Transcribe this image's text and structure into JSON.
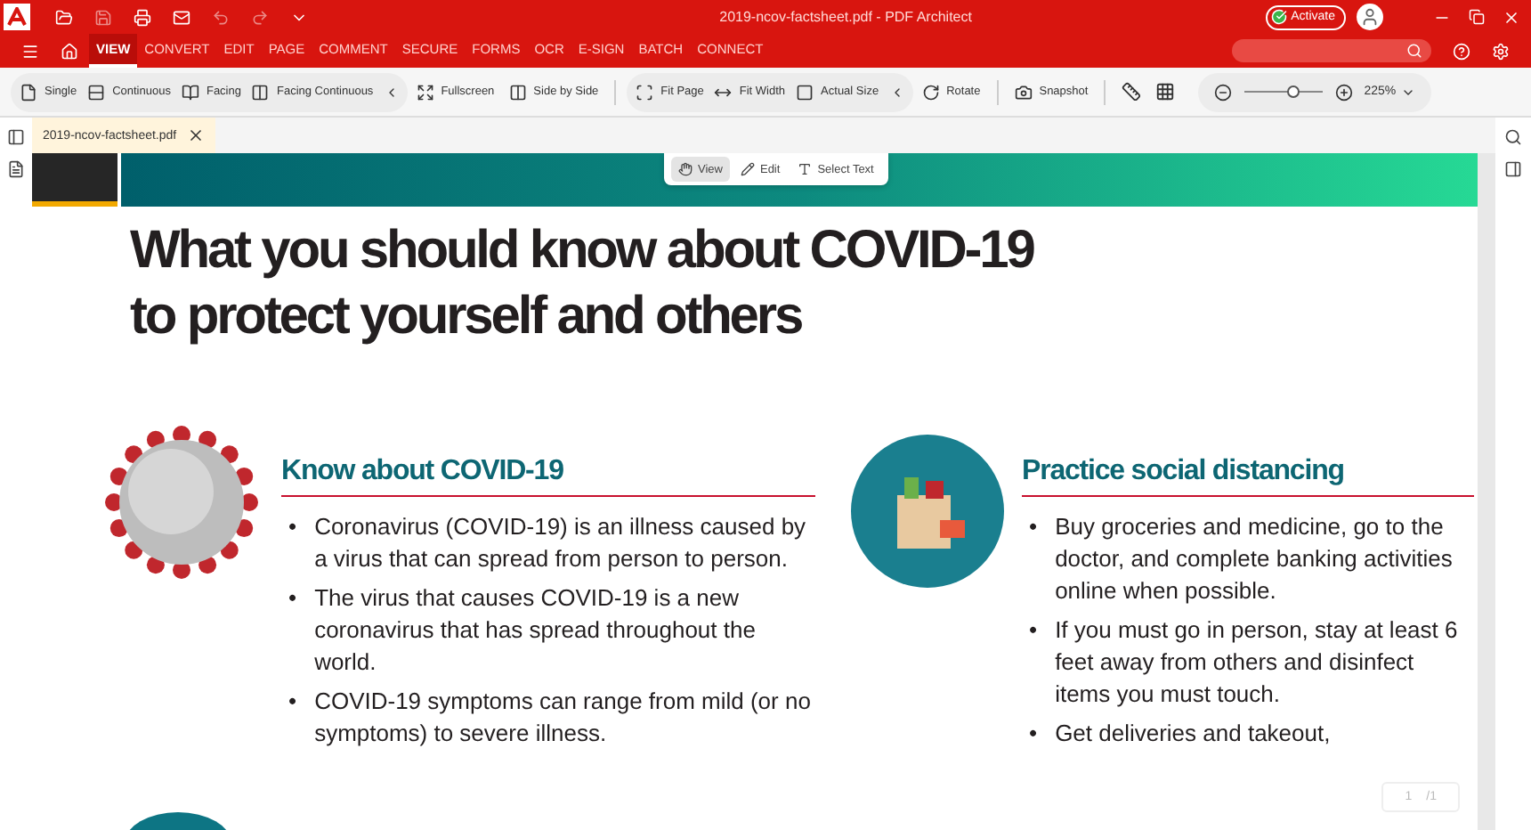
{
  "title_bar": {
    "title": "2019-ncov-factsheet.pdf  -  PDF Architect",
    "activate_button": "Activate"
  },
  "menu_tabs": [
    {
      "label": "VIEW",
      "selected": true
    },
    {
      "label": "CONVERT",
      "selected": false
    },
    {
      "label": "EDIT",
      "selected": false
    },
    {
      "label": "PAGE",
      "selected": false
    },
    {
      "label": "COMMENT",
      "selected": false
    },
    {
      "label": "SECURE",
      "selected": false
    },
    {
      "label": "FORMS",
      "selected": false
    },
    {
      "label": "OCR",
      "selected": false
    },
    {
      "label": "E-SIGN",
      "selected": false
    },
    {
      "label": "BATCH",
      "selected": false
    },
    {
      "label": "CONNECT",
      "selected": false
    }
  ],
  "toolbar": {
    "groups": [
      [
        "Single",
        "Continuous",
        "Facing",
        "Facing Continuous"
      ],
      [
        "Fullscreen",
        "Side by Side"
      ],
      [
        "Fit Page",
        "Fit Width",
        "Actual Size"
      ],
      [
        "Rotate"
      ],
      [
        "Snapshot"
      ]
    ],
    "zoom": {
      "level": 0.6,
      "reading": "225%"
    }
  },
  "document_tab": {
    "label": "2019-ncov-factsheet.pdf"
  },
  "mode_toolbar": [
    {
      "label": "View",
      "selected": true
    },
    {
      "label": "Edit",
      "selected": false
    },
    {
      "label": "Select Text",
      "selected": false
    }
  ],
  "document": {
    "heading": [
      "What you should know about COVID-19",
      "to protect yourself and others"
    ],
    "sections": [
      {
        "heading": "Know about COVID-19",
        "marker": "•",
        "bullets": [
          "Coronavirus (COVID-19) is an illness caused by a virus that can spread from person to person.",
          "The virus that causes COVID-19 is a new coronavirus that has spread throughout the world.",
          "COVID-19 symptoms can range from mild (or no symptoms) to severe illness."
        ]
      },
      {
        "heading": "Practice social distancing",
        "marker": "•",
        "bullets": [
          "Buy groceries and medicine, go to the doctor, and complete banking activities online when possible.",
          "If you must go in person, stay at least 6 feet away from others and disinfect items you must touch.",
          "Get deliveries and takeout,"
        ]
      }
    ]
  },
  "page_nav": {
    "current": "1",
    "total": "/1"
  }
}
